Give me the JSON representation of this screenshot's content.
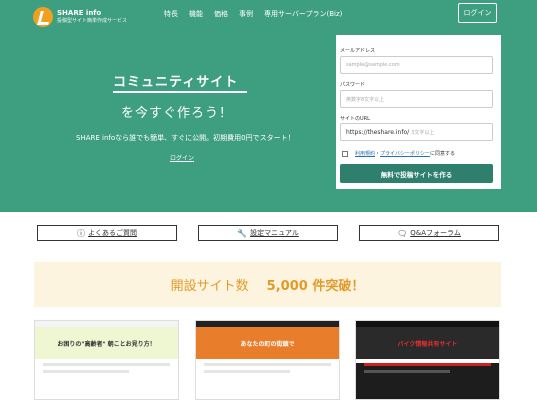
{
  "header": {
    "logo_name": "SHARE info",
    "logo_sub": "投稿型サイト簡単作成サービス",
    "nav": [
      "特長",
      "機能",
      "価格",
      "事例",
      "専用サーバープラン(Biz)"
    ],
    "login": "ログイン"
  },
  "hero": {
    "title": "コミュニティサイト",
    "subtitle": "を今すぐ作ろう！",
    "description": "SHARE infoなら誰でも簡単、すぐに公開。初期費用0円でスタート！",
    "login_link": "ログイン"
  },
  "form": {
    "email_label": "メールアドレス",
    "email_placeholder": "sample@sample.com",
    "password_label": "パスワード",
    "password_placeholder": "英数字8文字以上",
    "url_label": "サイトのURL",
    "url_prefix": "https://theshare.info/",
    "url_placeholder": "3文字以上",
    "terms_link": "利用規約",
    "separator": "・",
    "privacy_link": "プライバシーポリシー",
    "agree_suffix": "に同意する",
    "submit": "無料で投稿サイトを作る"
  },
  "links": {
    "faq": "よくあるご質問",
    "manual": "設定マニュアル",
    "forum": "Q&Aフォーラム"
  },
  "banner": {
    "label": "開設サイト数",
    "count": "5,000 件突破！"
  },
  "examples": [
    {
      "title": "お困りの\"高齢者\" 朝ことお見り方！"
    },
    {
      "title": "あなたの町の街頭で"
    },
    {
      "title": "バイク情報共有サイト"
    }
  ],
  "colors": {
    "hero_bg": "#3e9e80",
    "submit_bg": "#2f7f6e",
    "banner_bg": "#fdf4df",
    "banner_text": "#e39a2b"
  }
}
